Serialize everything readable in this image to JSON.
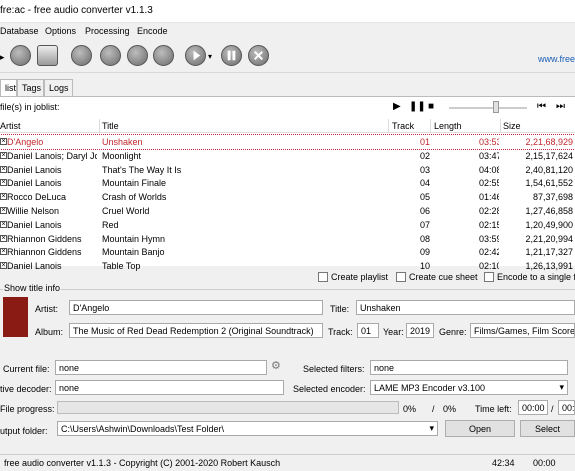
{
  "window": {
    "title": "fre:ac - free audio converter v1.1.3",
    "link": "www.free"
  },
  "menu": [
    "Database",
    "Options",
    "Processing",
    "Encode"
  ],
  "toolbar": {
    "icons": [
      "add-files-icon",
      "add-cd-icon",
      "remove-icon",
      "cddb-icon",
      "tools-icon",
      "eject-icon",
      "settings-icon",
      "play-icon",
      "pause-icon",
      "stop-icon"
    ]
  },
  "tabs": [
    "list",
    "Tags",
    "Logs"
  ],
  "joblist": {
    "count_text": "file(s) in joblist:",
    "columns": [
      "Artist",
      "Title",
      "Track",
      "Length",
      "Size"
    ],
    "rows": [
      {
        "artist": "D'Angelo",
        "title": "Unshaken",
        "track": "01",
        "length": "03:53",
        "size": "2,21,68,929"
      },
      {
        "artist": "Daniel Lanois; Daryl Jo",
        "title": "Moonlight",
        "track": "02",
        "length": "03:47",
        "size": "2,15,17,624"
      },
      {
        "artist": "Daniel Lanois",
        "title": "That's The Way It Is",
        "track": "03",
        "length": "04:08",
        "size": "2,40,81,120"
      },
      {
        "artist": "Daniel Lanois",
        "title": "Mountain Finale",
        "track": "04",
        "length": "02:55",
        "size": "1,54,61,552"
      },
      {
        "artist": "Rocco DeLuca",
        "title": "Crash of Worlds",
        "track": "05",
        "length": "01:46",
        "size": "87,37,698"
      },
      {
        "artist": "Willie Nelson",
        "title": "Cruel World",
        "track": "06",
        "length": "02:28",
        "size": "1,27,46,858"
      },
      {
        "artist": "Daniel Lanois",
        "title": "Red",
        "track": "07",
        "length": "02:15",
        "size": "1,20,49,900"
      },
      {
        "artist": "Rhiannon Giddens",
        "title": "Mountain Hymn",
        "track": "08",
        "length": "03:59",
        "size": "2,21,20,994"
      },
      {
        "artist": "Rhiannon Giddens",
        "title": "Mountain Banjo",
        "track": "09",
        "length": "02:42",
        "size": "1,21,17,327"
      },
      {
        "artist": "Daniel Lanois",
        "title": "Table Top",
        "track": "10",
        "length": "02:10",
        "size": "1,26,13,991"
      }
    ]
  },
  "options": {
    "create_playlist": "Create playlist",
    "create_cue_sheet": "Create cue sheet",
    "encode_single": "Encode to a single f"
  },
  "title_info": {
    "legend": "Show title info",
    "artist_label": "Artist:",
    "artist": "D'Angelo",
    "title_label": "Title:",
    "title": "Unshaken",
    "album_label": "Album:",
    "album": "The Music of Red Dead Redemption 2 (Original Soundtrack)",
    "track_label": "Track:",
    "track": "01",
    "year_label": "Year:",
    "year": "2019",
    "genre_label": "Genre:",
    "genre": "Films/Games, Film Score"
  },
  "status": {
    "current_file_label": "Current file:",
    "current_file": "none",
    "selected_filters_label": "Selected filters:",
    "selected_filters": "none",
    "active_decoder_label": "tive decoder:",
    "active_decoder": "none",
    "selected_encoder_label": "Selected encoder:",
    "selected_encoder": "LAME MP3 Encoder v3.100",
    "file_progress_label": "File progress:",
    "file_percent": "0%",
    "sep": "/",
    "total_percent": "0%",
    "time_left_label": "Time left:",
    "time_left": "00:00",
    "time_sep": "/",
    "time_total": "00:",
    "output_folder_label": "utput folder:",
    "output_folder": "C:\\Users\\Ashwin\\Downloads\\Test Folder\\",
    "open_button": "Open",
    "select_button": "Select"
  },
  "statusbar": {
    "text": "free audio converter v1.1.3 - Copyright (C) 2001-2020 Robert Kausch",
    "time": "42:34",
    "size": "00:00"
  }
}
